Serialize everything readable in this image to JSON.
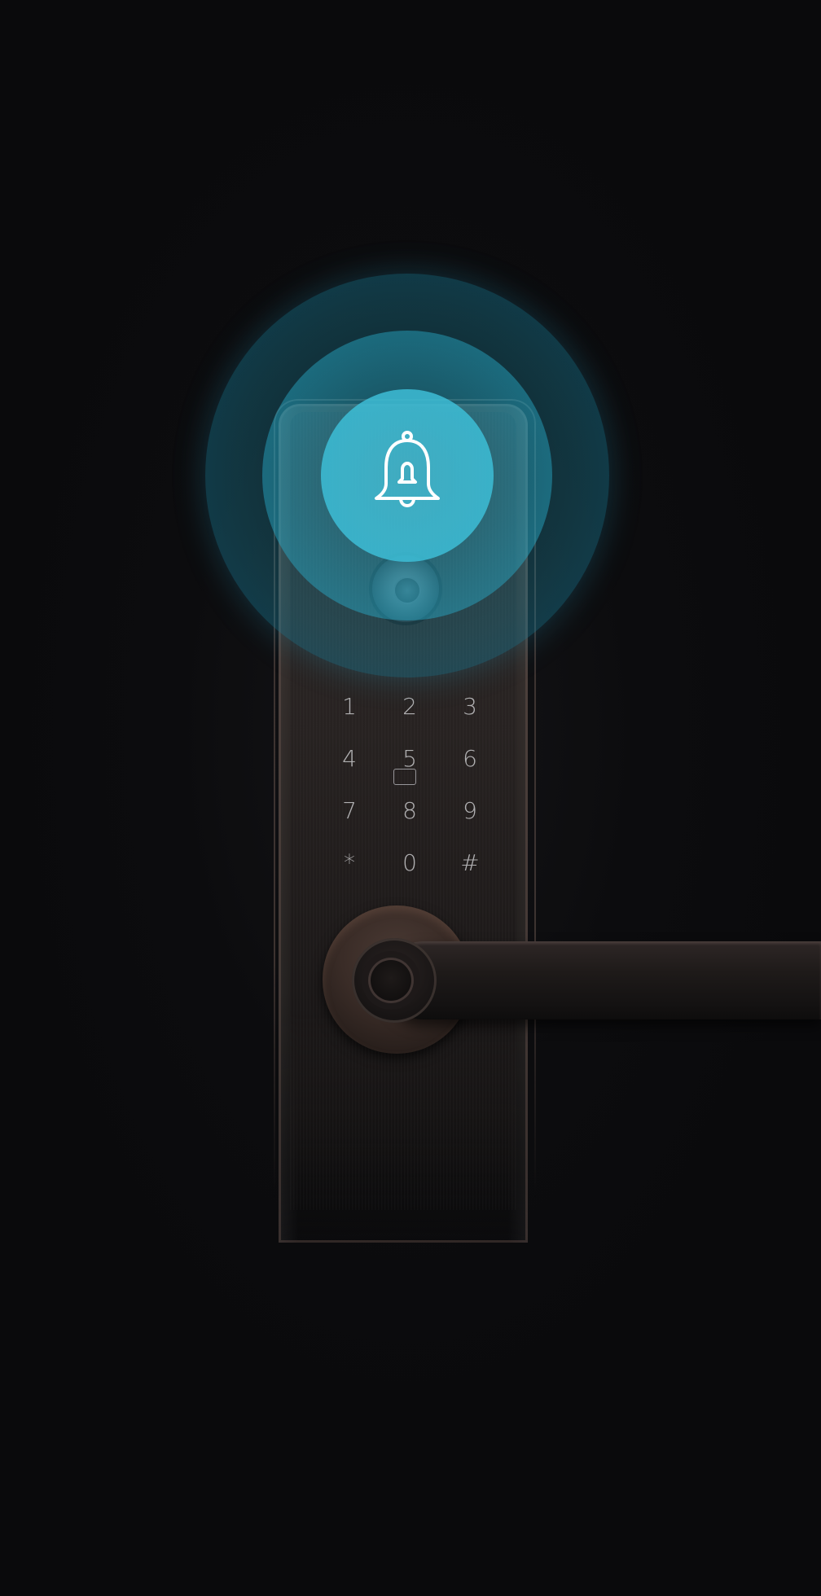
{
  "keypad": {
    "keys": [
      "1",
      "2",
      "3",
      "4",
      "5",
      "6",
      "7",
      "8",
      "9",
      "*",
      "0",
      "#"
    ]
  },
  "colors": {
    "background": "#0b0b0d",
    "ring_accent": "#32b4d2",
    "lock_finish": "#2f2928"
  },
  "icons": {
    "bell": "bell-icon",
    "card_reader": "card-reader-icon",
    "camera": "camera-icon",
    "keyhole": "keyhole-icon"
  }
}
